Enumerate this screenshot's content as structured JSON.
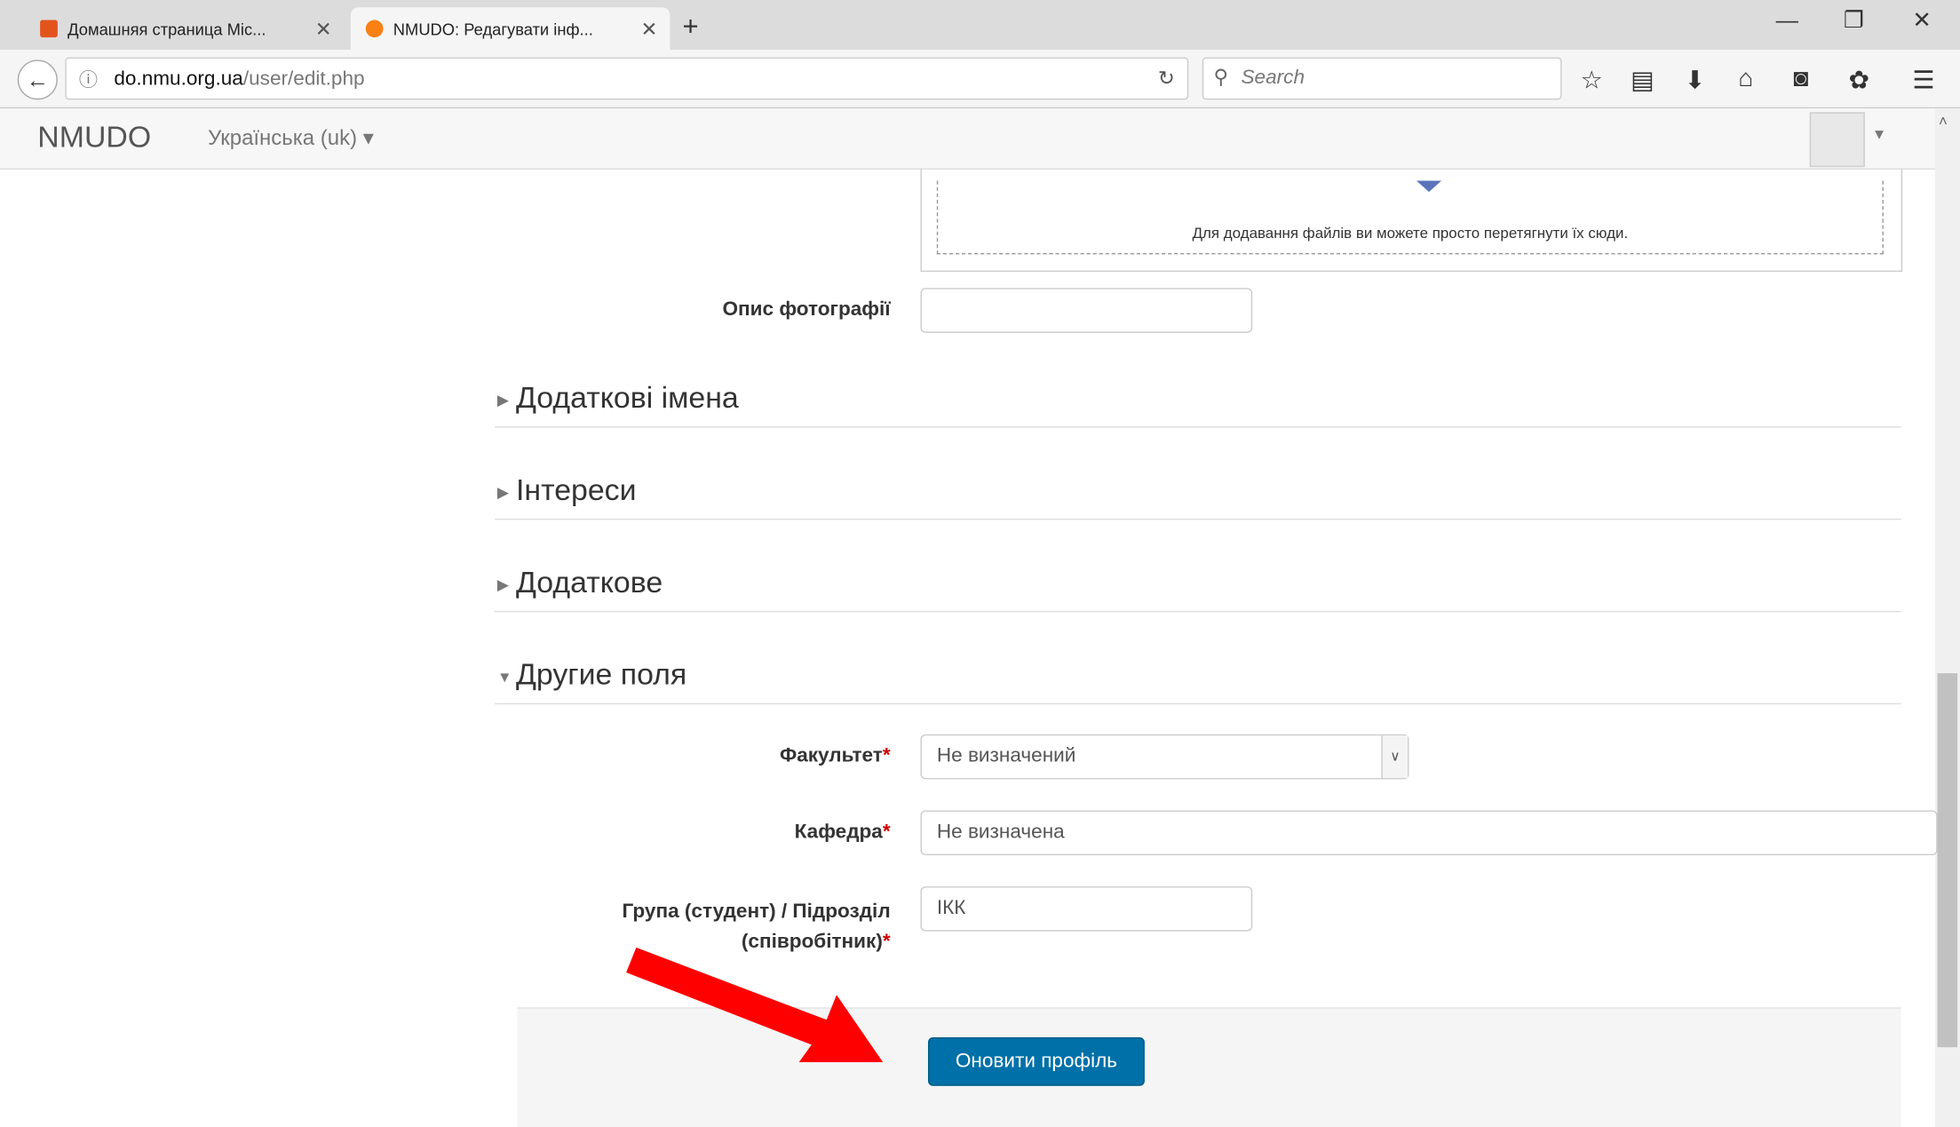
{
  "browser": {
    "tabs": [
      {
        "label": "Домашняя страница Mic..."
      },
      {
        "label": "NMUDO: Редагувати інф..."
      }
    ],
    "url_domain": "do.nmu.org.ua",
    "url_path": "/user/edit.php",
    "search_placeholder": "Search"
  },
  "site": {
    "brand": "NMUDO",
    "language": "Українська (uk) ▾"
  },
  "form": {
    "dropzone_text": "Для додавання файлів ви можете просто перетягнути їх сюди.",
    "photo_description_label": "Опис фотографії",
    "photo_description_value": "",
    "sections": [
      {
        "label": "Додаткові імена",
        "expanded": false
      },
      {
        "label": "Інтереси",
        "expanded": false
      },
      {
        "label": "Додаткове",
        "expanded": false
      },
      {
        "label": "Другие поля",
        "expanded": true
      }
    ],
    "faculty_label": "Факультет",
    "faculty_value": "Не визначений",
    "department_label": "Кафедра",
    "department_value": "Не визначена",
    "group_label_line1": "Група (студент) / Підрозділ",
    "group_label_line2": "(співробітник)",
    "group_value": "ІКК",
    "required_mark": "*",
    "submit_label": "Оновити профіль"
  },
  "colors": {
    "accent_button": "#0070a8",
    "annotation_arrow": "#ff0000",
    "required": "#cc0000"
  }
}
